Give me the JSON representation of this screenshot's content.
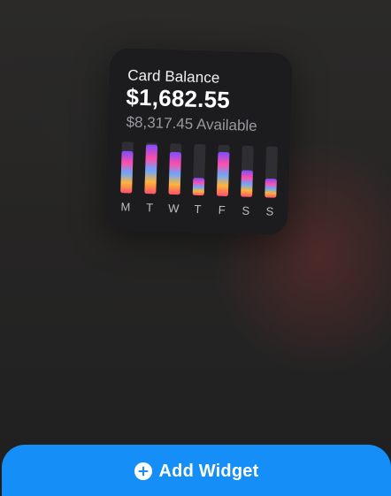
{
  "widget": {
    "title": "Card Balance",
    "balance": "$1,682.55",
    "available": "$8,317.45 Available"
  },
  "chart_data": {
    "type": "bar",
    "categories": [
      "M",
      "T",
      "W",
      "T",
      "F",
      "S",
      "S"
    ],
    "values": [
      0.82,
      0.96,
      0.83,
      0.34,
      0.86,
      0.52,
      0.37
    ],
    "ylim": [
      0,
      1
    ],
    "grid": false
  },
  "colors": {
    "track": "#2f2f33",
    "bar_gradient": [
      "#7b4dff",
      "#ff4fa8",
      "#6aa7ff",
      "#ffb43a",
      "#ff4f6a"
    ],
    "button": "#168ef7"
  },
  "icons": {
    "add": "plus-circle-icon"
  },
  "button": {
    "label": "Add Widget"
  }
}
